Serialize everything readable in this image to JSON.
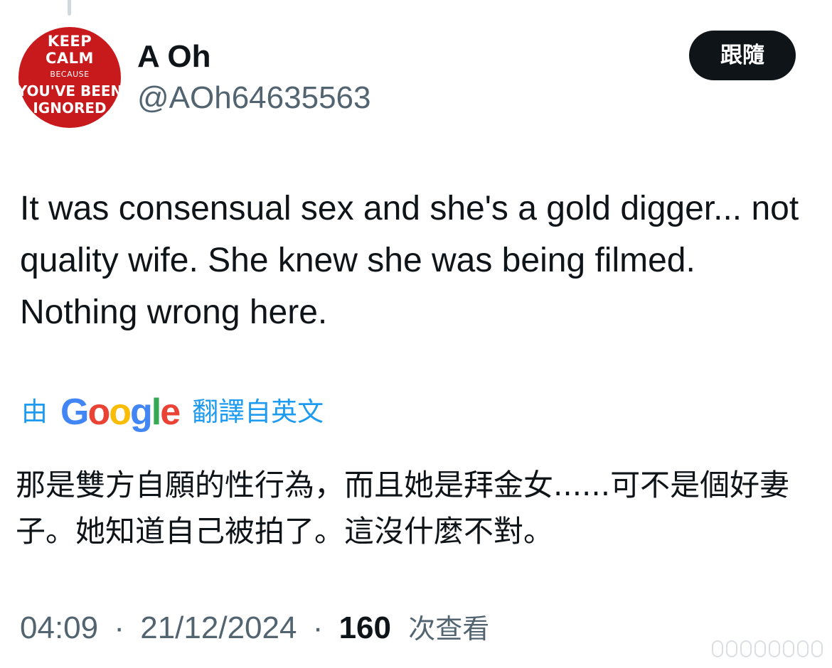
{
  "author": {
    "display_name": "A Oh",
    "handle": "@AOh64635563",
    "avatar_text": [
      "KEEP",
      "CALM",
      "BECAUSE",
      "YOU'VE BEEN",
      "IGNORED"
    ],
    "avatar_color": "#c8191c"
  },
  "follow_button": {
    "label": "跟隨"
  },
  "tweet": {
    "text": "It was consensual sex and she's a gold digger... not quality wife. She knew she was being filmed. Nothing wrong here."
  },
  "translation": {
    "prefix": "由",
    "provider": "Google",
    "suffix": "翻譯自英文",
    "text": "那是雙方自願的性行為，而且她是拜金女......可不是個好妻子。她知道自己被拍了。這沒什麼不對。"
  },
  "meta": {
    "time": "04:09",
    "separator": "·",
    "date": "21/12/2024",
    "views_count": "160",
    "views_label": "次查看"
  },
  "colors": {
    "link": "#1d9bf0",
    "text_primary": "#0f1419",
    "text_secondary": "#536471",
    "button_bg": "#0f1419"
  }
}
